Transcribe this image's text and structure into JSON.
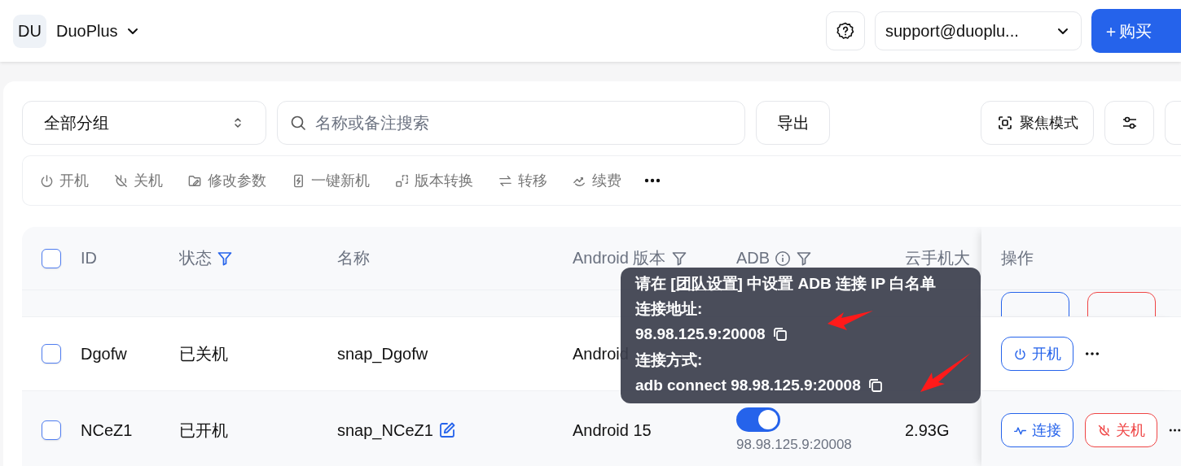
{
  "header": {
    "avatar": "DU",
    "workspace": "DuoPlus",
    "account": "support@duoplu...",
    "buy": "＋购买"
  },
  "toolbar": {
    "group_select": "全部分组",
    "search_placeholder": "名称或备注搜索",
    "export": "导出",
    "focus_mode": "聚焦模式"
  },
  "actions": [
    {
      "label": "开机"
    },
    {
      "label": "关机"
    },
    {
      "label": "修改参数"
    },
    {
      "label": "一键新机"
    },
    {
      "label": "版本转换"
    },
    {
      "label": "转移"
    },
    {
      "label": "续费"
    }
  ],
  "table": {
    "select_all": {
      "checked": false
    },
    "columns": [
      {
        "label": "ID"
      },
      {
        "label": "状态",
        "filter_active": true
      },
      {
        "label": "名称"
      },
      {
        "label": "Android 版本",
        "filter_active": false
      },
      {
        "label": "ADB",
        "filter_active": false
      },
      {
        "label": "云手机大"
      },
      {
        "label": "操作"
      }
    ],
    "rows": [
      {
        "id": "Dgofw",
        "status": "已关机",
        "name": "snap_Dgofw",
        "editable": false,
        "android": "Android",
        "size": "",
        "hovered": false,
        "checked": false,
        "buttons": [
          {
            "label": "开机",
            "kind": "power-on"
          }
        ]
      },
      {
        "id": "NCeZ1",
        "status": "已开机",
        "name": "snap_NCeZ1",
        "editable": true,
        "android": "Android 15",
        "adb": {
          "on": true,
          "address": "98.98.125.9:20008"
        },
        "size": "2.93G",
        "hovered": true,
        "checked": false,
        "buttons": [
          {
            "label": "连接",
            "kind": "connect"
          },
          {
            "label": "关机",
            "kind": "power-off"
          }
        ]
      }
    ]
  },
  "tooltip": {
    "prefix": "请在 [",
    "link": "团队设置",
    "suffix": "] 中设置 ADB 连接 IP 白名单",
    "address_label": "连接地址:",
    "address": "98.98.125.9:20008",
    "method_label": "连接方式:",
    "command": "adb connect 98.98.125.9:20008"
  }
}
